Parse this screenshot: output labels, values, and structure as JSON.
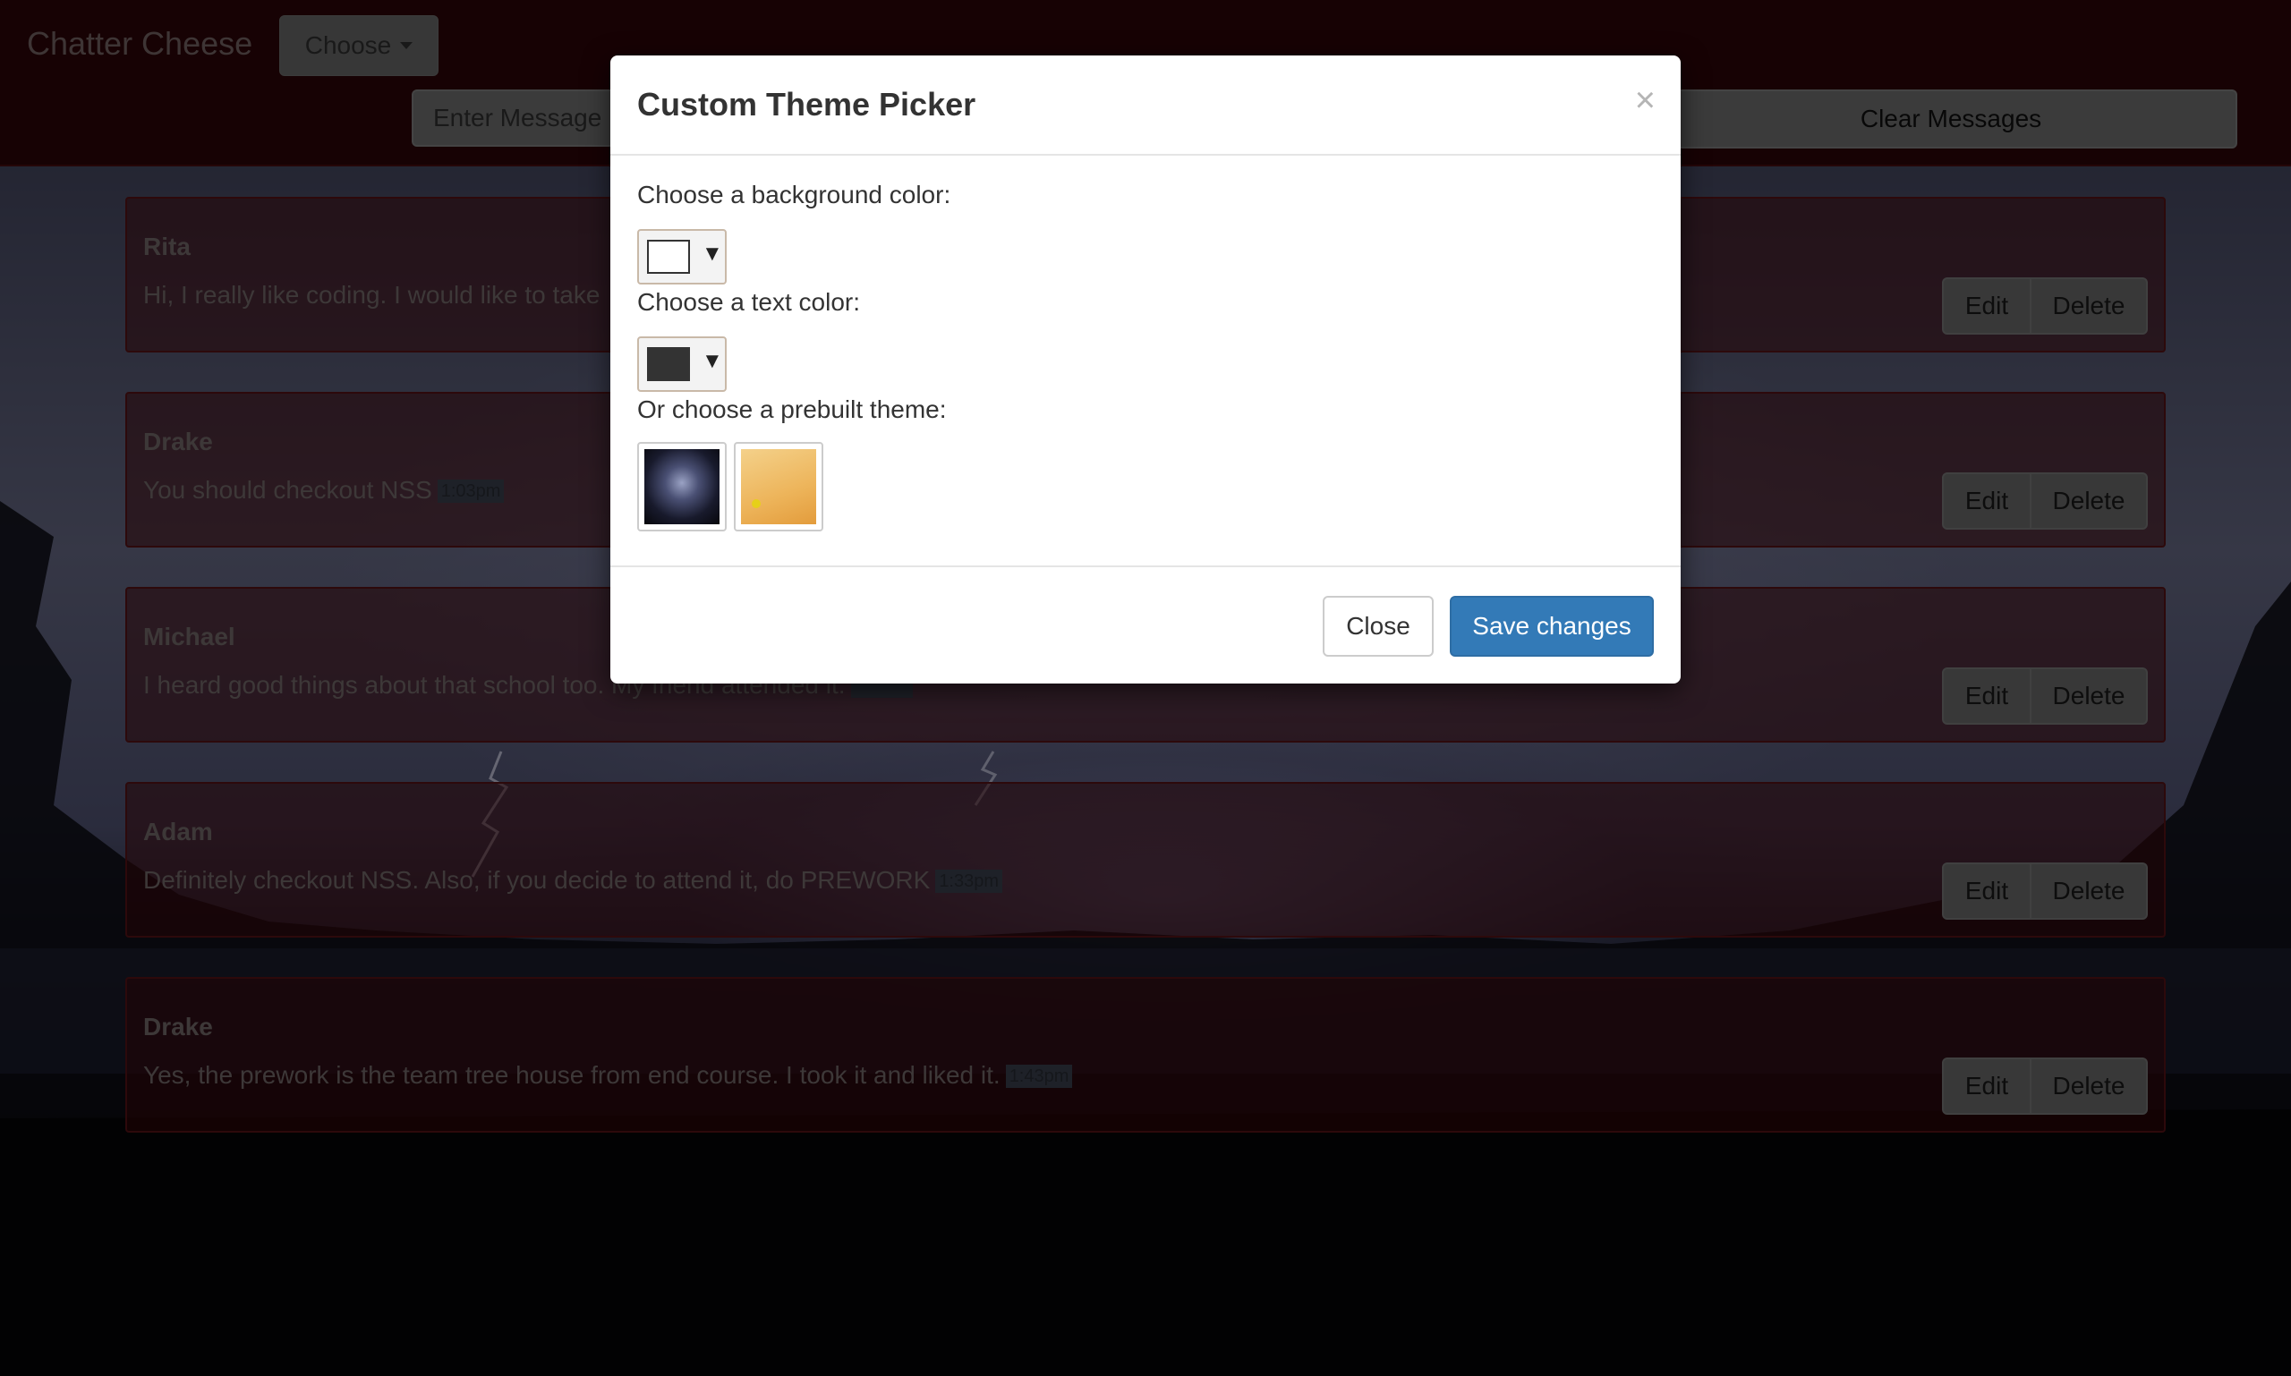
{
  "app": {
    "brand": "Chatter Cheese",
    "choose_label": "Choose"
  },
  "toolbar": {
    "message_placeholder": "Enter Message",
    "clear_label": "Clear Messages"
  },
  "messages": [
    {
      "author": "Rita",
      "text": "Hi, I really like coding. I would like to take",
      "time": ""
    },
    {
      "author": "Drake",
      "text": "You should checkout NSS",
      "time": "1:03pm"
    },
    {
      "author": "Michael",
      "text": "I heard good things about that school too. My friend attended it.",
      "time": ""
    },
    {
      "author": "Adam",
      "text": "Definitely checkout NSS. Also, if you decide to attend it, do PREWORK",
      "time": "1:33pm"
    },
    {
      "author": "Drake",
      "text": "Yes, the prework is the team tree house from end course. I took it and liked it.",
      "time": "1:43pm"
    }
  ],
  "message_actions": {
    "edit_label": "Edit",
    "delete_label": "Delete"
  },
  "modal": {
    "title": "Custom Theme Picker",
    "close_icon": "×",
    "bg_color_label": "Choose a background color:",
    "text_color_label": "Choose a text color:",
    "prebuilt_label": "Or choose a prebuilt theme:",
    "dropdown_arrow": "▼",
    "bg_color_value": "#ffffff",
    "text_color_value": "#333333",
    "themes": [
      {
        "name": "storm-theme-thumbnail"
      },
      {
        "name": "sunny-theme-thumbnail"
      }
    ],
    "close_label": "Close",
    "save_label": "Save changes"
  }
}
